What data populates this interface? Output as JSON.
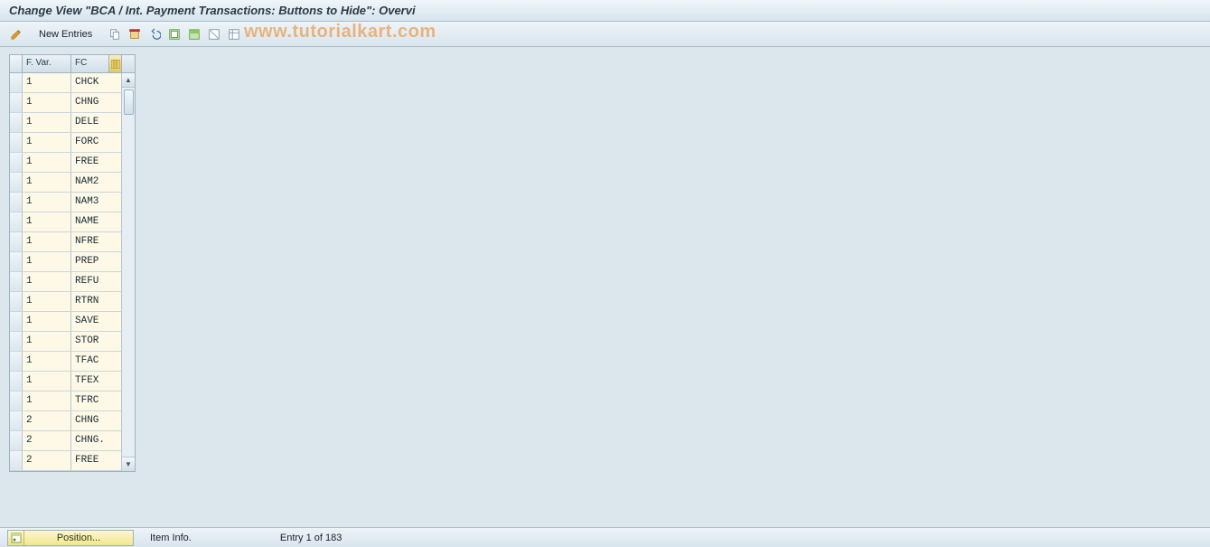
{
  "title": "Change View \"BCA / Int. Payment Transactions: Buttons to Hide\": Overvi",
  "toolbar": {
    "new_entries_label": "New Entries"
  },
  "watermark": "www.tutorialkart.com",
  "grid": {
    "col_fvar": "F. Var.",
    "col_fc": "FC",
    "rows": [
      {
        "fvar": "1",
        "fc": "CHCK"
      },
      {
        "fvar": "1",
        "fc": "CHNG"
      },
      {
        "fvar": "1",
        "fc": "DELE"
      },
      {
        "fvar": "1",
        "fc": "FORC"
      },
      {
        "fvar": "1",
        "fc": "FREE"
      },
      {
        "fvar": "1",
        "fc": "NAM2"
      },
      {
        "fvar": "1",
        "fc": "NAM3"
      },
      {
        "fvar": "1",
        "fc": "NAME"
      },
      {
        "fvar": "1",
        "fc": "NFRE"
      },
      {
        "fvar": "1",
        "fc": "PREP"
      },
      {
        "fvar": "1",
        "fc": "REFU"
      },
      {
        "fvar": "1",
        "fc": "RTRN"
      },
      {
        "fvar": "1",
        "fc": "SAVE"
      },
      {
        "fvar": "1",
        "fc": "STOR"
      },
      {
        "fvar": "1",
        "fc": "TFAC"
      },
      {
        "fvar": "1",
        "fc": "TFEX"
      },
      {
        "fvar": "1",
        "fc": "TFRC"
      },
      {
        "fvar": "2",
        "fc": "CHNG"
      },
      {
        "fvar": "2",
        "fc": "CHNG."
      },
      {
        "fvar": "2",
        "fc": "FREE"
      }
    ]
  },
  "footer": {
    "position_label": "Position...",
    "item_info": "Item Info.",
    "entry_status": "Entry 1 of 183"
  }
}
